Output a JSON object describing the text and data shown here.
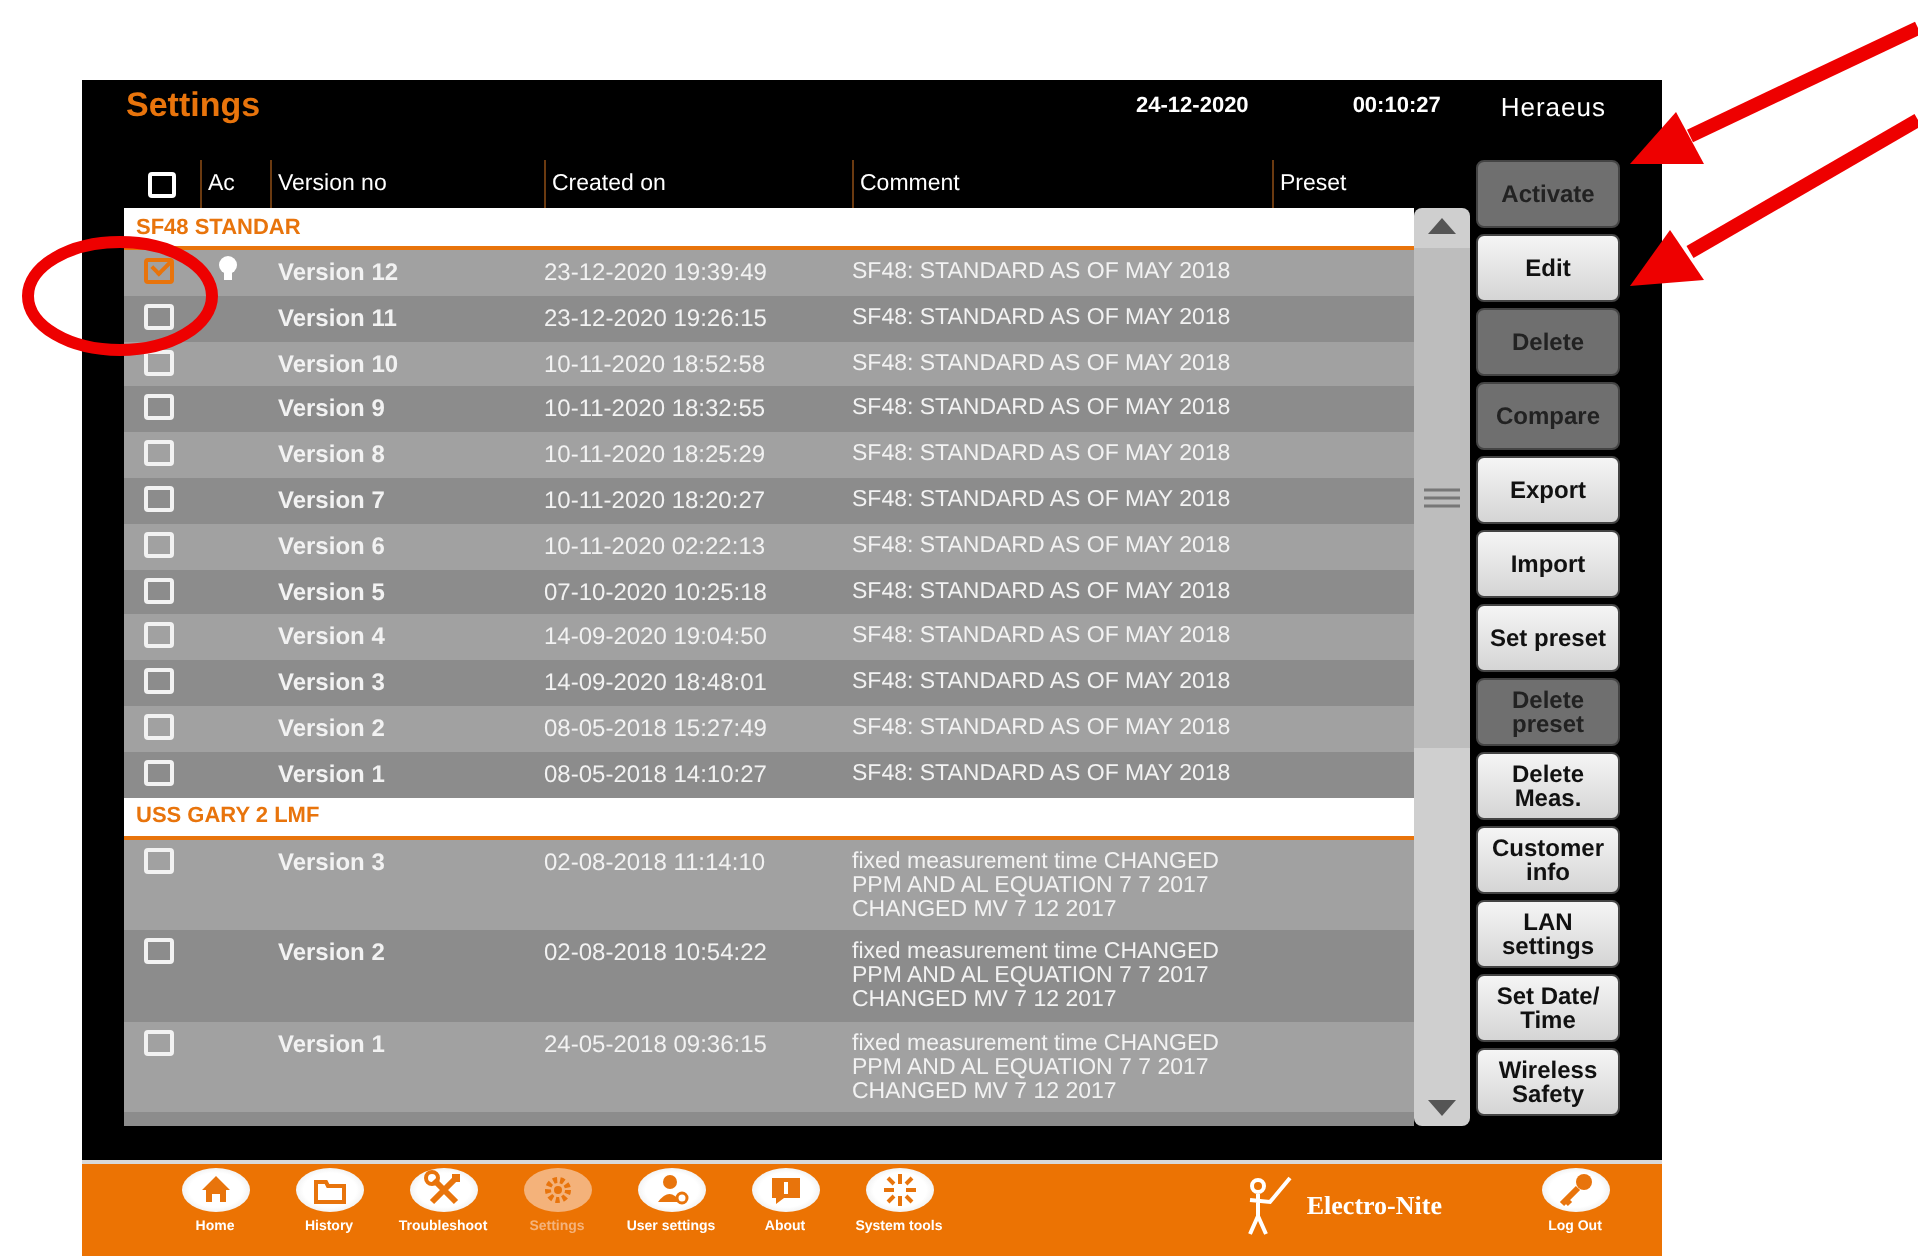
{
  "header": {
    "title": "Settings",
    "date": "24-12-2020",
    "time": "00:10:27",
    "brand": "Heraeus"
  },
  "table": {
    "select_all": {
      "checked": false
    },
    "columns": [
      "Ac",
      "Version no",
      "Created on",
      "Comment",
      "Preset"
    ],
    "groups": [
      {
        "name": "SF48 STANDAR",
        "rows": [
          {
            "version": "Version 12",
            "created": "23-12-2020 19:39:49",
            "comment": "SF48: STANDARD AS OF MAY 2018",
            "checked": true,
            "active": true
          },
          {
            "version": "Version 11",
            "created": "23-12-2020 19:26:15",
            "comment": "SF48: STANDARD AS OF MAY 2018",
            "checked": false,
            "active": false
          },
          {
            "version": "Version 10",
            "created": "10-11-2020 18:52:58",
            "comment": "SF48: STANDARD AS OF MAY 2018",
            "checked": false,
            "active": false
          },
          {
            "version": "Version 9",
            "created": "10-11-2020 18:32:55",
            "comment": "SF48: STANDARD AS OF MAY 2018",
            "checked": false,
            "active": false
          },
          {
            "version": "Version 8",
            "created": "10-11-2020 18:25:29",
            "comment": "SF48: STANDARD AS OF MAY 2018",
            "checked": false,
            "active": false
          },
          {
            "version": "Version 7",
            "created": "10-11-2020 18:20:27",
            "comment": "SF48: STANDARD AS OF MAY 2018",
            "checked": false,
            "active": false
          },
          {
            "version": "Version 6",
            "created": "10-11-2020 02:22:13",
            "comment": "SF48: STANDARD AS OF MAY 2018",
            "checked": false,
            "active": false
          },
          {
            "version": "Version 5",
            "created": "07-10-2020 10:25:18",
            "comment": "SF48: STANDARD AS OF MAY 2018",
            "checked": false,
            "active": false
          },
          {
            "version": "Version 4",
            "created": "14-09-2020 19:04:50",
            "comment": "SF48: STANDARD AS OF MAY 2018",
            "checked": false,
            "active": false
          },
          {
            "version": "Version 3",
            "created": "14-09-2020 18:48:01",
            "comment": "SF48: STANDARD AS OF MAY 2018",
            "checked": false,
            "active": false
          },
          {
            "version": "Version 2",
            "created": "08-05-2018 15:27:49",
            "comment": "SF48: STANDARD AS OF MAY 2018",
            "checked": false,
            "active": false
          },
          {
            "version": "Version 1",
            "created": "08-05-2018 14:10:27",
            "comment": "SF48: STANDARD AS OF MAY 2018",
            "checked": false,
            "active": false
          }
        ]
      },
      {
        "name": "USS GARY 2 LMF",
        "rows": [
          {
            "version": "Version 3",
            "created": "02-08-2018 11:14:10",
            "comment": "fixed measurement time CHANGED PPM AND AL EQUATION 7 7 2017 CHANGED MV 7 12 2017",
            "checked": false,
            "active": false
          },
          {
            "version": "Version 2",
            "created": "02-08-2018 10:54:22",
            "comment": "fixed measurement time CHANGED PPM AND AL EQUATION 7 7 2017 CHANGED MV 7 12 2017",
            "checked": false,
            "active": false
          },
          {
            "version": "Version 1",
            "created": "24-05-2018 09:36:15",
            "comment": "fixed measurement time CHANGED PPM AND AL EQUATION 7 7 2017 CHANGED MV 7 12 2017",
            "checked": false,
            "active": false
          }
        ]
      }
    ]
  },
  "buttons": [
    {
      "label": "Activate",
      "disabled": true
    },
    {
      "label": "Edit",
      "disabled": false
    },
    {
      "label": "Delete",
      "disabled": true
    },
    {
      "label": "Compare",
      "disabled": true
    },
    {
      "label": "Export",
      "disabled": false
    },
    {
      "label": "Import",
      "disabled": false
    },
    {
      "label": "Set preset",
      "disabled": false
    },
    {
      "label": "Delete preset",
      "disabled": true
    },
    {
      "label": "Delete Meas.",
      "disabled": false
    },
    {
      "label": "Customer info",
      "disabled": false
    },
    {
      "label": "LAN settings",
      "disabled": false
    },
    {
      "label": "Set Date/ Time",
      "disabled": false
    },
    {
      "label": "Wireless Safety",
      "disabled": false
    }
  ],
  "nav": [
    {
      "label": "Home",
      "kind": "home",
      "selected": false
    },
    {
      "label": "History",
      "kind": "folder",
      "selected": false
    },
    {
      "label": "Troubleshoot",
      "kind": "tools",
      "selected": false
    },
    {
      "label": "Settings",
      "kind": "gear",
      "selected": true
    },
    {
      "label": "User settings",
      "kind": "user",
      "selected": false
    },
    {
      "label": "About",
      "kind": "info",
      "selected": false
    },
    {
      "label": "System tools",
      "kind": "burst",
      "selected": false
    }
  ],
  "logo": "Electro-Nite",
  "logout": "Log Out"
}
